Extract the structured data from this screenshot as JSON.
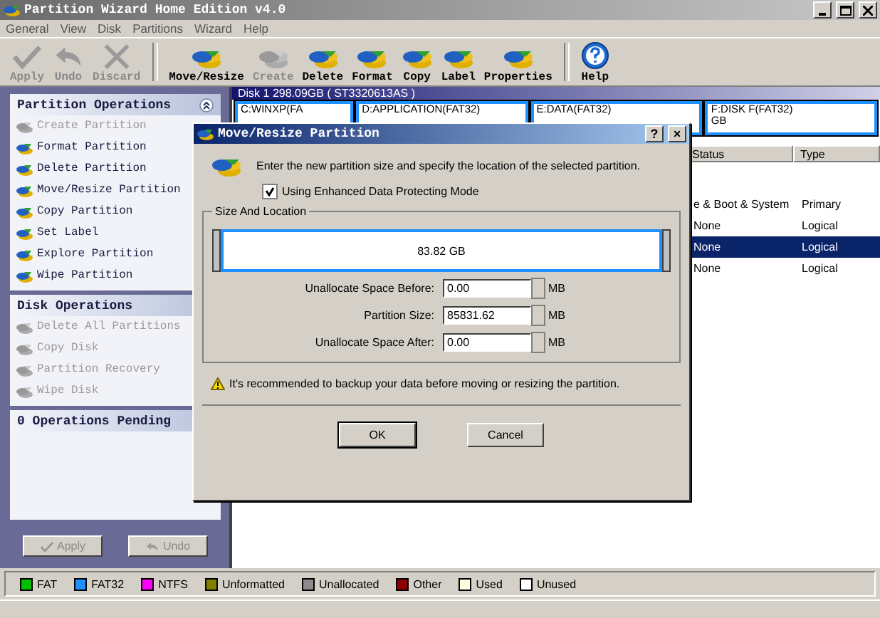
{
  "window": {
    "title": "Partition Wizard Home Edition v4.0"
  },
  "menu": [
    "General",
    "View",
    "Disk",
    "Partitions",
    "Wizard",
    "Help"
  ],
  "toolbar": [
    {
      "label": "Apply",
      "kind": "check",
      "disabled": true
    },
    {
      "label": "Undo",
      "kind": "undo",
      "disabled": true
    },
    {
      "label": "Discard",
      "kind": "discard",
      "disabled": true
    },
    {
      "label": "Move/Resize",
      "kind": "disk",
      "disabled": false
    },
    {
      "label": "Create",
      "kind": "disk",
      "disabled": true
    },
    {
      "label": "Delete",
      "kind": "disk",
      "disabled": false
    },
    {
      "label": "Format",
      "kind": "disk",
      "disabled": false
    },
    {
      "label": "Copy",
      "kind": "disk",
      "disabled": false
    },
    {
      "label": "Label",
      "kind": "disk",
      "disabled": false
    },
    {
      "label": "Properties",
      "kind": "disk",
      "disabled": false
    },
    {
      "label": "Help",
      "kind": "help",
      "disabled": false
    }
  ],
  "sidebar": {
    "sections": [
      {
        "title": "Partition Operations",
        "collapsible": true,
        "items": [
          {
            "label": "Create Partition",
            "disabled": true
          },
          {
            "label": "Format Partition",
            "disabled": false
          },
          {
            "label": "Delete Partition",
            "disabled": false
          },
          {
            "label": "Move/Resize Partition",
            "disabled": false
          },
          {
            "label": "Copy Partition",
            "disabled": false
          },
          {
            "label": "Set Label",
            "disabled": false
          },
          {
            "label": "Explore Partition",
            "disabled": false
          },
          {
            "label": "Wipe Partition",
            "disabled": false
          }
        ]
      },
      {
        "title": "Disk Operations",
        "items": [
          {
            "label": "Delete All Partitions",
            "disabled": true
          },
          {
            "label": "Copy Disk",
            "disabled": true
          },
          {
            "label": "Partition Recovery",
            "disabled": true
          },
          {
            "label": "Wipe Disk",
            "disabled": true
          }
        ]
      },
      {
        "title": "0 Operations Pending"
      }
    ],
    "buttons": [
      {
        "label": "Apply",
        "kind": "check",
        "disabled": true
      },
      {
        "label": "Undo",
        "kind": "undo",
        "disabled": true
      }
    ]
  },
  "disk_map": {
    "title": "Disk 1 298.09GB  ( ST3320613AS )",
    "partitions": [
      {
        "label": "C:WINXP(FA",
        "selected": false
      },
      {
        "label": "D:APPLICATION(FAT32)",
        "selected": false
      },
      {
        "label": "E:DATA(FAT32)",
        "selected": false
      },
      {
        "label": "F:DISK F(FAT32)",
        "detail": "GB",
        "selected": false
      }
    ]
  },
  "table": {
    "columns": [
      "Status",
      "Type"
    ],
    "rows": [
      {
        "cells": [
          "e & Boot & System",
          "Primary"
        ],
        "selected": false
      },
      {
        "cells": [
          "None",
          "Logical"
        ],
        "selected": false
      },
      {
        "cells": [
          "None",
          "Logical"
        ],
        "selected": true
      },
      {
        "cells": [
          "None",
          "Logical"
        ],
        "selected": false
      }
    ]
  },
  "dialog": {
    "title": "Move/Resize Partition",
    "title_buttons": [
      "?",
      "×"
    ],
    "description": "Enter the new partition size and specify the location of the selected partition.",
    "checkbox": {
      "label": "Using Enhanced Data Protecting Mode",
      "checked": true
    },
    "group_title": "Size And Location",
    "partition_bar": {
      "label": "83.82 GB"
    },
    "fields": [
      {
        "label": "Unallocate Space Before:",
        "value": "0.00",
        "unit": "MB"
      },
      {
        "label": "Partition Size:",
        "value": "85831.62",
        "unit": "MB"
      },
      {
        "label": "Unallocate Space After:",
        "value": "0.00",
        "unit": "MB"
      }
    ],
    "warning": "It's recommended to backup your data before moving or resizing the partition.",
    "buttons": [
      "OK",
      "Cancel"
    ]
  },
  "legend": [
    {
      "label": "FAT",
      "color": "#00c000"
    },
    {
      "label": "FAT32",
      "color": "#1e90ff"
    },
    {
      "label": "NTFS",
      "color": "#ff00ff"
    },
    {
      "label": "Unformatted",
      "color": "#808000"
    },
    {
      "label": "Unallocated",
      "color": "#8c8c8c"
    },
    {
      "label": "Other",
      "color": "#8b0000"
    },
    {
      "label": "Used",
      "color": "#ffffe0"
    },
    {
      "label": "Unused",
      "color": "#ffffff"
    }
  ]
}
